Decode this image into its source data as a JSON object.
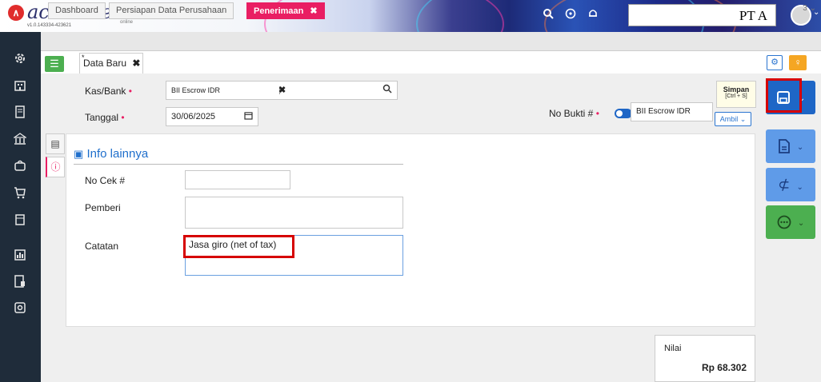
{
  "brand": {
    "name": "accurate",
    "sub": "online",
    "version": "v1.0.143334-423621"
  },
  "company": "PT A",
  "tabs": [
    {
      "label": "Dashboard"
    },
    {
      "label": "Persiapan Data Perusahaan"
    },
    {
      "label": "Penerimaan",
      "close": "✖"
    }
  ],
  "tab_count": "3 ⌄",
  "doc_tab": {
    "star": "*",
    "label": "Data Baru",
    "close": "✖"
  },
  "form": {
    "kas_bank_label": "Kas/Bank",
    "kas_bank_value": "BII Escrow IDR",
    "kas_bank_clear": "✖",
    "tanggal_label": "Tanggal",
    "tanggal_value": "30/06/2025",
    "no_bukti_label": "No Bukti #",
    "no_bukti_value": "BII Escrow IDR",
    "required_mark": "•",
    "ambil_label": "Ambil ⌄"
  },
  "info": {
    "title": "Info lainnya",
    "no_cek_label": "No Cek #",
    "no_cek_value": "",
    "pemberi_label": "Pemberi",
    "pemberi_value": "",
    "catatan_label": "Catatan",
    "catatan_value": "Jasa giro (net of tax)"
  },
  "tooltip": {
    "title": "Simpan",
    "shortcut": "[Ctrl + S]"
  },
  "nilai": {
    "label": "Nilai",
    "value": "Rp 68.302"
  },
  "colors": {
    "accent_pink": "#e91e63",
    "primary_blue": "#1e66c6",
    "success_green": "#4caf50",
    "sidebar_dark": "#1f2c3a",
    "highlight_red": "#d60000"
  },
  "icons": {
    "sidebar": [
      "gear-icon",
      "building-icon",
      "document-icon",
      "bank-icon",
      "bag-icon",
      "cart-icon",
      "shopping-icon",
      "chart-icon",
      "report-icon",
      "settings-icon"
    ],
    "topbar": [
      "search-icon",
      "help-icon",
      "bell-icon"
    ]
  }
}
